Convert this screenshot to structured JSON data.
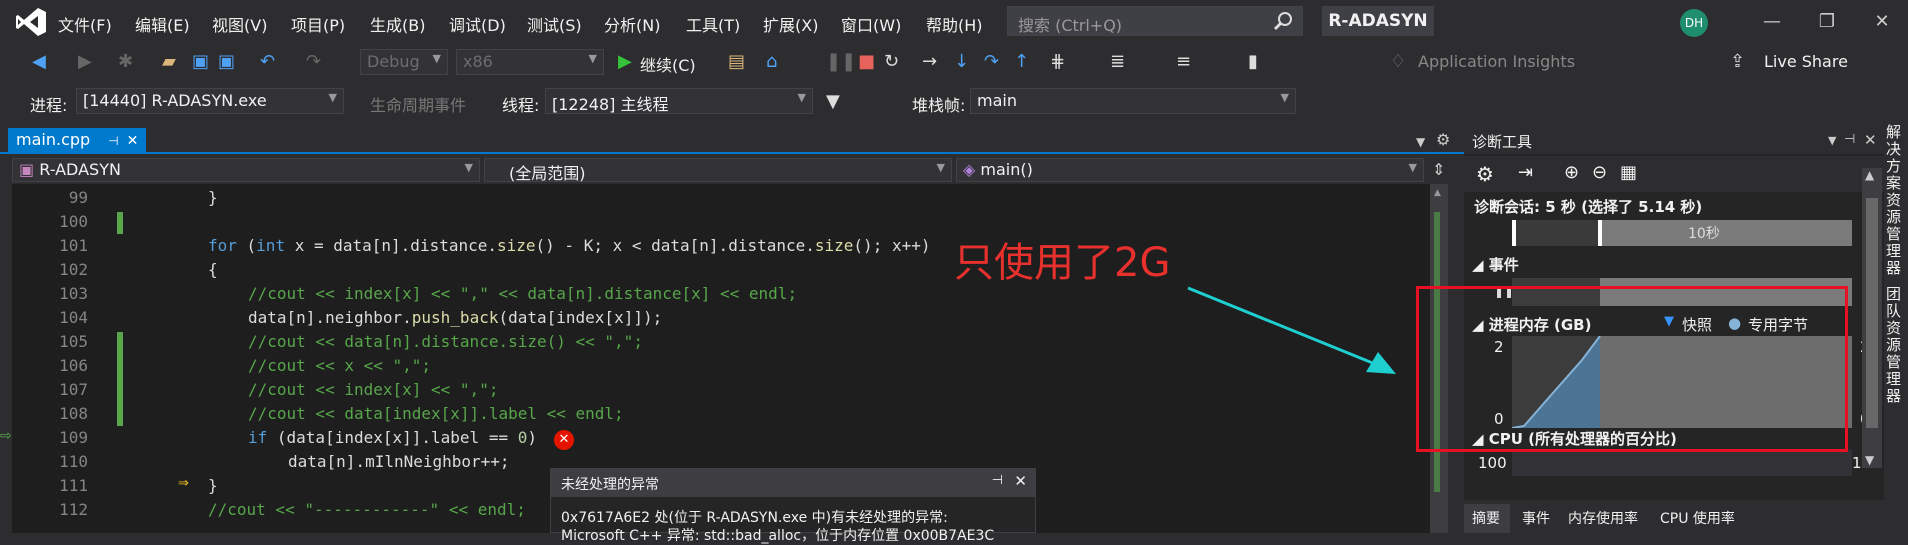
{
  "menubar": {
    "items": [
      "文件(F)",
      "编辑(E)",
      "视图(V)",
      "项目(P)",
      "生成(B)",
      "调试(D)",
      "测试(S)",
      "分析(N)",
      "工具(T)",
      "扩展(X)",
      "窗口(W)",
      "帮助(H)"
    ],
    "search_placeholder": "搜索 (Ctrl+Q)",
    "project": "R-ADASYN",
    "avatar": "DH"
  },
  "toolbar": {
    "config": "Debug",
    "platform": "x86",
    "continue": "继续(C)",
    "insights": "Application Insights",
    "live_share": "Live Share"
  },
  "debugbar": {
    "process_label": "进程:",
    "process": "[14440] R-ADASYN.exe",
    "lifecycle": "生命周期事件",
    "thread_label": "线程:",
    "thread": "[12248] 主线程",
    "stack_label": "堆栈帧:",
    "stack": "main"
  },
  "editor": {
    "tab": "main.cpp",
    "project_scope": "R-ADASYN",
    "global_scope": "(全局范围)",
    "func_scope": "main()"
  },
  "code_lines": [
    {
      "n": "99"
    },
    {
      "n": "100"
    },
    {
      "n": "101"
    },
    {
      "n": "102"
    },
    {
      "n": "103"
    },
    {
      "n": "104"
    },
    {
      "n": "105"
    },
    {
      "n": "106"
    },
    {
      "n": "107"
    },
    {
      "n": "108"
    },
    {
      "n": "109"
    },
    {
      "n": "110"
    },
    {
      "n": "111"
    },
    {
      "n": "112"
    }
  ],
  "exception": {
    "title": "未经处理的异常",
    "body": "0x7617A6E2 处(位于 R-ADASYN.exe 中)有未经处理的异常:",
    "body2": "Microsoft C++ 异常: std::bad_alloc，位于内存位置 0x00B7AE3C"
  },
  "annotation": "只使用了2G",
  "diag": {
    "title": "诊断工具",
    "session": "诊断会话: 5 秒 (选择了 5.14 秒)",
    "tick": "10秒",
    "events": "事件",
    "mem": "进程内存 (GB)",
    "snapshot": "快照",
    "private": "专用字节",
    "mem_max": "2",
    "mem_min": "0",
    "cpu": "CPU (所有处理器的百分比)",
    "cpu_max": "100",
    "tabs": [
      "摘要",
      "事件",
      "内存使用率",
      "CPU 使用率"
    ]
  },
  "side": {
    "solution": "解决方案资源管理器",
    "team": "团队资源管理器"
  },
  "colors": {
    "accent": "#007acc",
    "annotation": "#e8302d",
    "arrow": "#1fcfd0"
  }
}
